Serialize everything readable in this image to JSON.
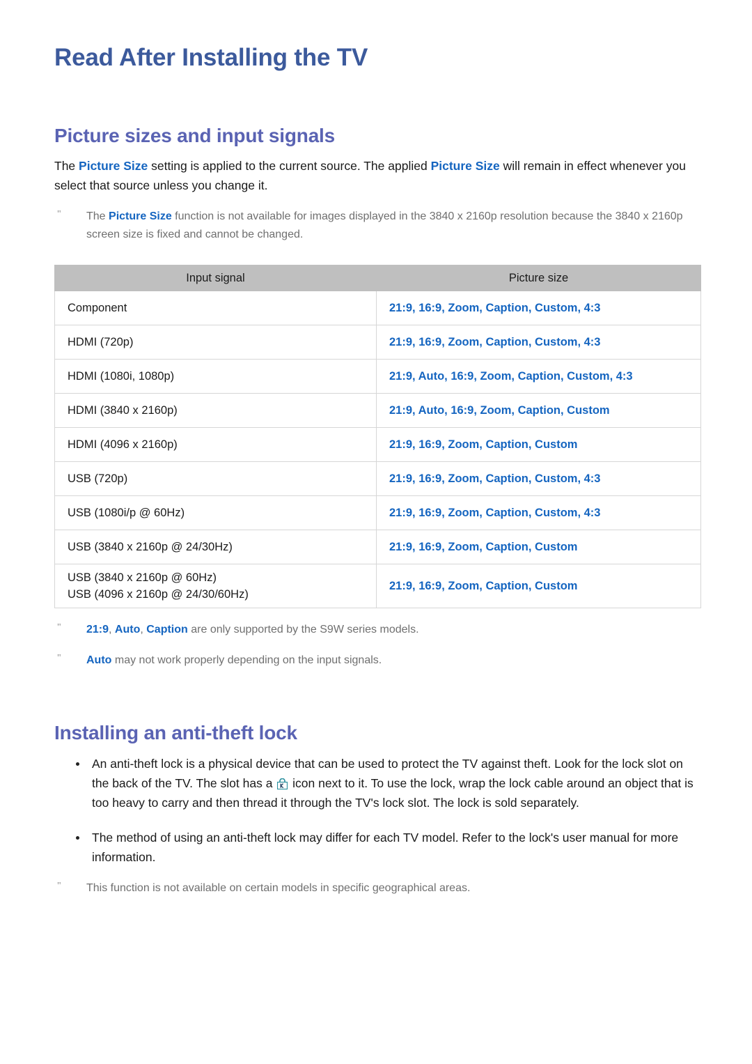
{
  "document": {
    "title": "Read After Installing the TV"
  },
  "section_picture": {
    "heading": "Picture sizes and input signals",
    "intro": {
      "part1": "The ",
      "accent1": "Picture Size",
      "part2": " setting is applied to the current source. The applied ",
      "accent2": "Picture Size",
      "part3": " will remain in effect whenever you select that source unless you change it."
    },
    "note_marker": "\"",
    "note1": {
      "part1": "The ",
      "accent1": "Picture Size",
      "part2": " function is not available for images displayed in the 3840 x 2160p resolution because the 3840 x 2160p screen size is fixed and cannot be changed."
    },
    "table": {
      "headers": [
        "Input signal",
        "Picture size"
      ],
      "rows": [
        {
          "signal": "Component",
          "signal2": "",
          "sizes": "21:9, 16:9, Zoom, Caption, Custom, 4:3"
        },
        {
          "signal": "HDMI (720p)",
          "signal2": "",
          "sizes": "21:9, 16:9, Zoom, Caption, Custom, 4:3"
        },
        {
          "signal": "HDMI (1080i, 1080p)",
          "signal2": "",
          "sizes": "21:9, Auto, 16:9, Zoom, Caption, Custom, 4:3"
        },
        {
          "signal": "HDMI (3840 x 2160p)",
          "signal2": "",
          "sizes": "21:9, Auto, 16:9, Zoom, Caption, Custom"
        },
        {
          "signal": "HDMI (4096 x 2160p)",
          "signal2": "",
          "sizes": "21:9, 16:9, Zoom, Caption, Custom"
        },
        {
          "signal": "USB (720p)",
          "signal2": "",
          "sizes": "21:9, 16:9, Zoom, Caption, Custom, 4:3"
        },
        {
          "signal": "USB (1080i/p @ 60Hz)",
          "signal2": "",
          "sizes": "21:9, 16:9, Zoom, Caption, Custom, 4:3"
        },
        {
          "signal": "USB (3840 x 2160p @ 24/30Hz)",
          "signal2": "",
          "sizes": "21:9, 16:9, Zoom, Caption, Custom"
        },
        {
          "signal": "USB (3840 x 2160p @ 60Hz)",
          "signal2": "USB (4096 x 2160p @ 24/30/60Hz)",
          "sizes": "21:9, 16:9, Zoom, Caption, Custom"
        }
      ]
    },
    "note2": {
      "accent1": "21:9",
      "sep1": ", ",
      "accent2": "Auto",
      "sep2": ", ",
      "accent3": "Caption",
      "part1": " are only supported by the S9W series models."
    },
    "note3": {
      "accent1": "Auto",
      "part1": " may not work properly depending on the input signals."
    }
  },
  "section_lock": {
    "heading": "Installing an anti-theft lock",
    "bullet1": {
      "part1": "An anti-theft lock is a physical device that can be used to protect the TV against theft. Look for the lock slot on the back of the TV. The slot has a ",
      "icon": "lock-icon",
      "part2": " icon next to it. To use the lock, wrap the lock cable around an object that is too heavy to carry and then thread it through the TV's lock slot. The lock is sold separately."
    },
    "bullet2": "The method of using an anti-theft lock may differ for each TV model. Refer to the lock's user manual for more information.",
    "note_marker": "\"",
    "note1": "This function is not available on certain models in specific geographical areas."
  },
  "colors": {
    "title_blue": "#3c5a9c",
    "heading_blue": "#5a63b3",
    "accent_blue": "#1565c0",
    "table_header_gray": "#bfbfbf",
    "note_gray": "#6f6f6f",
    "lock_icon_teal": "#2a8f9e"
  }
}
